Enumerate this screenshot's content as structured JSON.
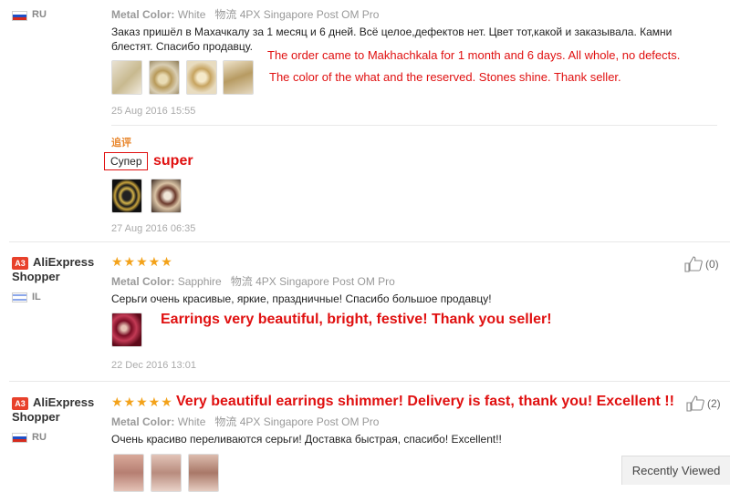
{
  "reviews": [
    {
      "country": "RU",
      "meta_color_label": "Metal Color:",
      "meta_color_value": "White",
      "meta_shipping": "物流 4PX Singapore Post OM Pro",
      "feedback": "Заказ пришёл в Махачкалу за 1 месяц и 6 дней. Всё целое,дефектов нет. Цвет тот,какой и заказывала. Камни блестят. Спасибо продавцу.",
      "annotation_1": "The order came to Makhachkala for 1 month and 6 days. All whole, no defects.",
      "annotation_2": "The color of the what and the reserved. Stones shine. Thank seller.",
      "date": "25 Aug 2016 15:55",
      "followup_label": "追评",
      "followup_text": "Супер",
      "followup_annotation": "super",
      "followup_date": "27 Aug 2016 06:35"
    },
    {
      "badge": "A3",
      "user": "AliExpress Shopper",
      "country": "IL",
      "stars": "★★★★★",
      "meta_color_label": "Metal Color:",
      "meta_color_value": "Sapphire",
      "meta_shipping": "物流 4PX Singapore Post OM Pro",
      "feedback": "Серьги очень красивые, яркие, праздничные! Спасибо большое продавцу!",
      "annotation": "Earrings very beautiful, bright, festive! Thank you seller!",
      "date": "22 Dec 2016 13:01",
      "helpful": "(0)"
    },
    {
      "badge": "A3",
      "user": "AliExpress Shopper",
      "country": "RU",
      "stars": "★★★★★",
      "annotation": "Very beautiful earrings shimmer! Delivery is fast, thank you! Excellent !!",
      "meta_color_label": "Metal Color:",
      "meta_color_value": "White",
      "meta_shipping": "物流 4PX Singapore Post OM Pro",
      "feedback": "Очень красиво переливаются серьги! Доставка быстрая, спасибо! Excellent!!",
      "helpful": "(2)"
    }
  ],
  "recently_viewed": "Recently Viewed"
}
